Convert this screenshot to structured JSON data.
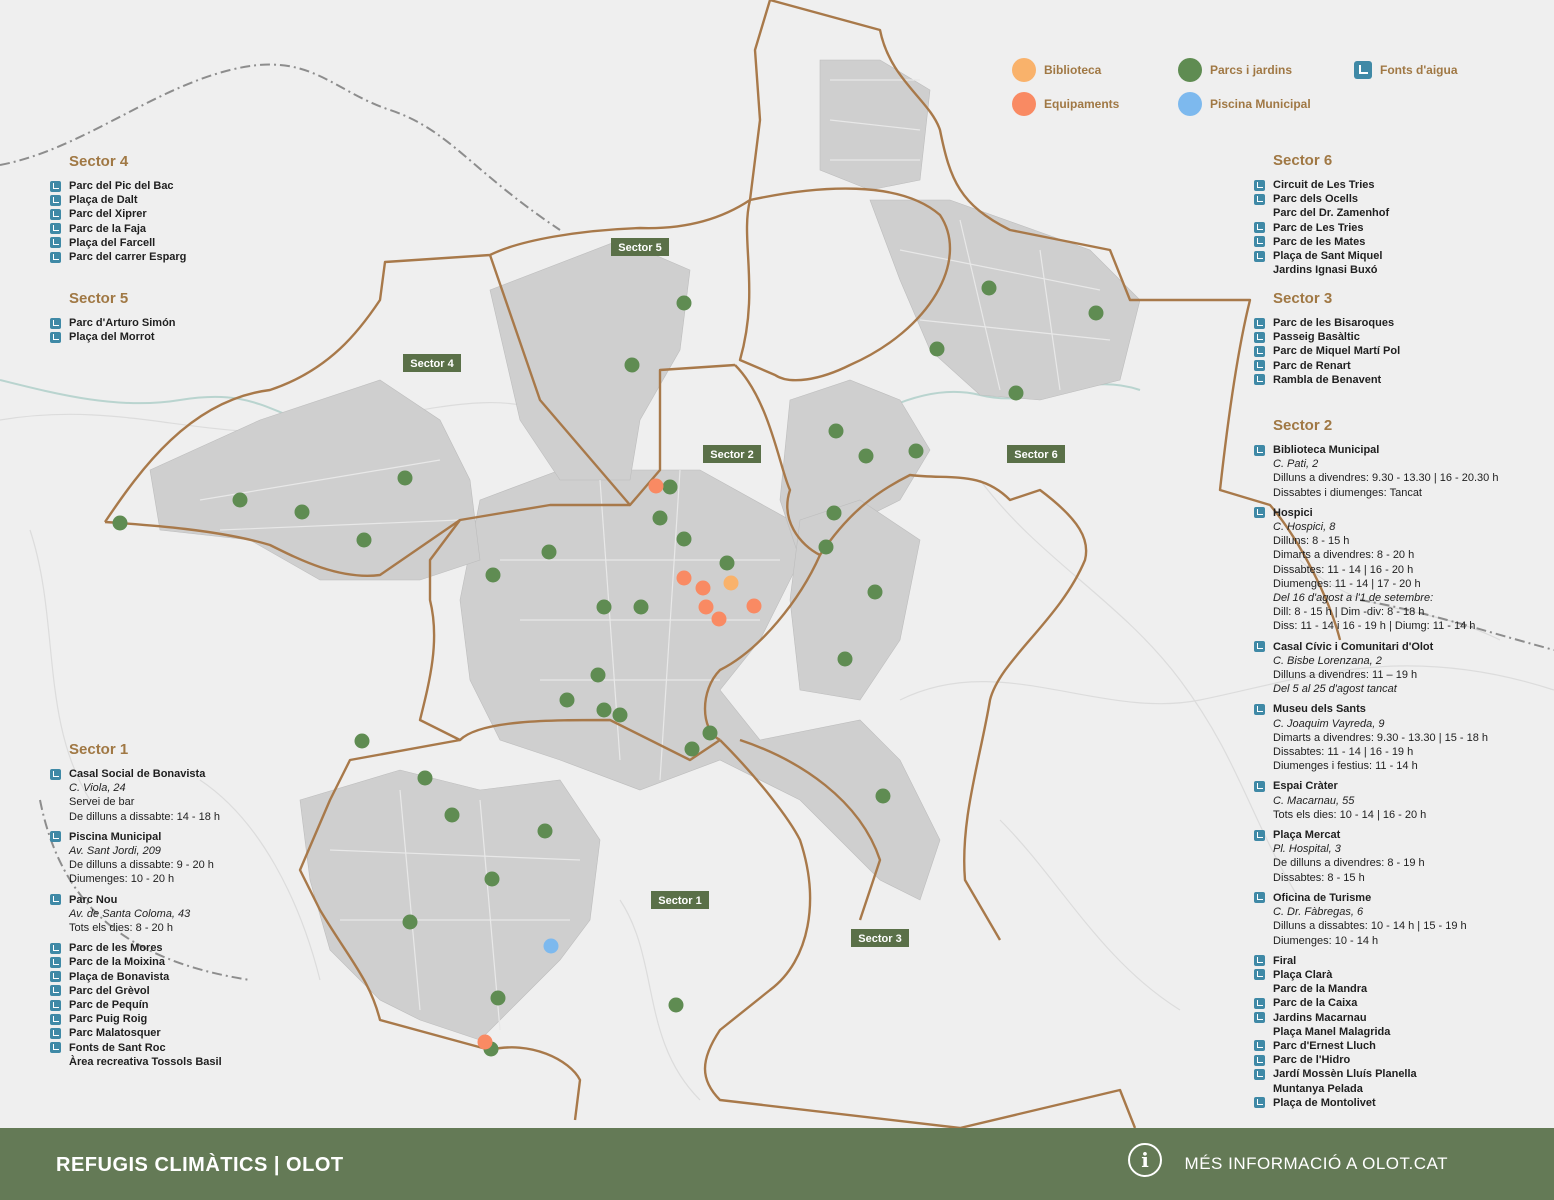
{
  "legend": [
    {
      "label": "Biblioteca",
      "color": "#f9b26b",
      "kind": "dot"
    },
    {
      "label": "Equipaments",
      "color": "#f98a63",
      "kind": "dot"
    },
    {
      "label": "Parcs i jardins",
      "color": "#5f8c52",
      "kind": "dot"
    },
    {
      "label": "Piscina Municipal",
      "color": "#7db9ee",
      "kind": "dot"
    },
    {
      "label": "Fonts d'aigua",
      "color": "#3f89a6",
      "kind": "tap-icon"
    }
  ],
  "map_labels": [
    "Sector 5",
    "Sector 4",
    "Sector 2",
    "Sector 6",
    "Sector 1",
    "Sector 3"
  ],
  "left_panel": {
    "sector4": {
      "title": "Sector 4",
      "items": [
        {
          "name": "Parc del Pic del Bac",
          "tap": true
        },
        {
          "name": "Plaça de Dalt",
          "tap": true
        },
        {
          "name": "Parc del Xiprer",
          "tap": true
        },
        {
          "name": "Parc de la Faja",
          "tap": true
        },
        {
          "name": "Plaça del Farcell",
          "tap": true
        },
        {
          "name": "Parc del carrer Esparg",
          "tap": true
        }
      ]
    },
    "sector5": {
      "title": "Sector 5",
      "items": [
        {
          "name": "Parc d'Arturo Simón",
          "tap": true
        },
        {
          "name": "Plaça del Morrot",
          "tap": true
        }
      ]
    },
    "sector1": {
      "title": "Sector 1",
      "details": [
        {
          "name": "Casal Social de Bonavista",
          "address": "C. Viola, 24",
          "lines": [
            "Servei de bar",
            "De dilluns a dissabte: 14 - 18 h"
          ]
        },
        {
          "name": "Piscina Municipal",
          "address": "Av. Sant Jordi, 209",
          "lines": [
            "De dilluns a dissabte: 9 - 20 h",
            "Diumenges: 10 - 20 h"
          ]
        },
        {
          "name": "Parc Nou",
          "address": "Av. de Santa Coloma, 43",
          "lines": [
            "Tots els dies: 8 - 20 h"
          ]
        }
      ],
      "items": [
        {
          "name": "Parc de les Mores",
          "tap": true
        },
        {
          "name": "Parc de la Moixina",
          "tap": true
        },
        {
          "name": "Plaça de Bonavista",
          "tap": true
        },
        {
          "name": "Parc del Grèvol",
          "tap": true
        },
        {
          "name": "Parc de Pequín",
          "tap": true
        },
        {
          "name": "Parc Puig Roig",
          "tap": true
        },
        {
          "name": "Parc Malatosquer",
          "tap": true
        },
        {
          "name": "Fonts de Sant Roc",
          "tap": true
        },
        {
          "name": "Àrea recreativa Tossols Basil",
          "tap": false
        }
      ]
    }
  },
  "right_panel": {
    "sector6": {
      "title": "Sector 6",
      "items": [
        {
          "name": "Circuit de Les Tries",
          "tap": true
        },
        {
          "name": "Parc dels Ocells",
          "tap": true
        },
        {
          "name": "Parc del Dr. Zamenhof",
          "tap": false
        },
        {
          "name": "Parc de Les Tries",
          "tap": true
        },
        {
          "name": "Parc de les Mates",
          "tap": true
        },
        {
          "name": "Plaça de Sant Miquel",
          "tap": true
        },
        {
          "name": "Jardins Ignasi Buxó",
          "tap": false
        }
      ]
    },
    "sector3": {
      "title": "Sector 3",
      "items": [
        {
          "name": "Parc de les Bisaroques",
          "tap": true
        },
        {
          "name": "Passeig Basàltic",
          "tap": true
        },
        {
          "name": "Parc de Miquel Martí Pol",
          "tap": true
        },
        {
          "name": "Parc de Renart",
          "tap": true
        },
        {
          "name": "Rambla de Benavent",
          "tap": true
        }
      ]
    },
    "sector2": {
      "title": "Sector 2",
      "details": [
        {
          "name": "Biblioteca Municipal",
          "address": "C. Pati, 2",
          "lines": [
            "Dilluns a divendres: 9.30 - 13.30 | 16 - 20.30 h",
            "Dissabtes i diumenges: Tancat"
          ]
        },
        {
          "name": "Hospici",
          "address": "C. Hospici, 8",
          "lines": [
            "Dilluns: 8 - 15 h",
            "Dimarts a divendres: 8 - 20 h",
            "Dissabtes: 11 - 14 | 16 - 20 h",
            "Diumenges: 11 - 14 | 17 - 20 h",
            {
              "it": "Del 16 d'agost a l'1 de setembre:"
            },
            "Dill: 8 - 15 h | Dim -div: 8 - 18 h",
            "Diss: 11 - 14 i 16 - 19 h | Diumg: 11 - 14 h"
          ]
        },
        {
          "name": "Casal Cívic i Comunitari d'Olot",
          "address": "C. Bisbe Lorenzana, 2",
          "lines": [
            "Dilluns a divendres: 11 – 19 h",
            {
              "it": "Del 5 al 25 d'agost tancat"
            }
          ]
        },
        {
          "name": "Museu dels Sants",
          "address": "C. Joaquim Vayreda, 9",
          "lines": [
            "Dimarts a divendres: 9.30 - 13.30 | 15 - 18 h",
            "Dissabtes: 11 - 14 | 16 - 19 h",
            "Diumenges i festius: 11 - 14 h"
          ]
        },
        {
          "name": "Espai Cràter",
          "address": "C. Macarnau, 55",
          "lines": [
            "Tots els dies: 10 - 14 | 16 - 20 h"
          ]
        },
        {
          "name": "Plaça Mercat",
          "address": "Pl. Hospital, 3",
          "lines": [
            "De dilluns a divendres: 8 - 19 h",
            "Dissabtes: 8 - 15 h"
          ]
        },
        {
          "name": "Oficina de Turisme",
          "address": "C. Dr. Fàbregas, 6",
          "lines": [
            "Dilluns a dissabtes: 10 - 14 h | 15 - 19 h",
            "Diumenges: 10 - 14 h"
          ]
        }
      ],
      "items": [
        {
          "name": "Firal",
          "tap": true
        },
        {
          "name": "Plaça Clarà",
          "tap": true
        },
        {
          "name": "Parc de la Mandra",
          "tap": false
        },
        {
          "name": "Parc de la Caixa",
          "tap": true
        },
        {
          "name": "Jardins Macarnau",
          "tap": true
        },
        {
          "name": "Plaça Manel Malagrida",
          "tap": false
        },
        {
          "name": "Parc d'Ernest Lluch",
          "tap": true
        },
        {
          "name": "Parc de l'Hidro",
          "tap": true
        },
        {
          "name": "Jardí Mossèn Lluís Planella",
          "tap": true
        },
        {
          "name": "Muntanya Pelada",
          "tap": false
        },
        {
          "name": "Plaça de Montolivet",
          "tap": true
        }
      ]
    }
  },
  "footer": {
    "title": "REFUGIS CLIMÀTICS | OLOT",
    "info": "MÉS INFORMACIÓ A OLOT.CAT",
    "info_icon": "info-icon"
  }
}
